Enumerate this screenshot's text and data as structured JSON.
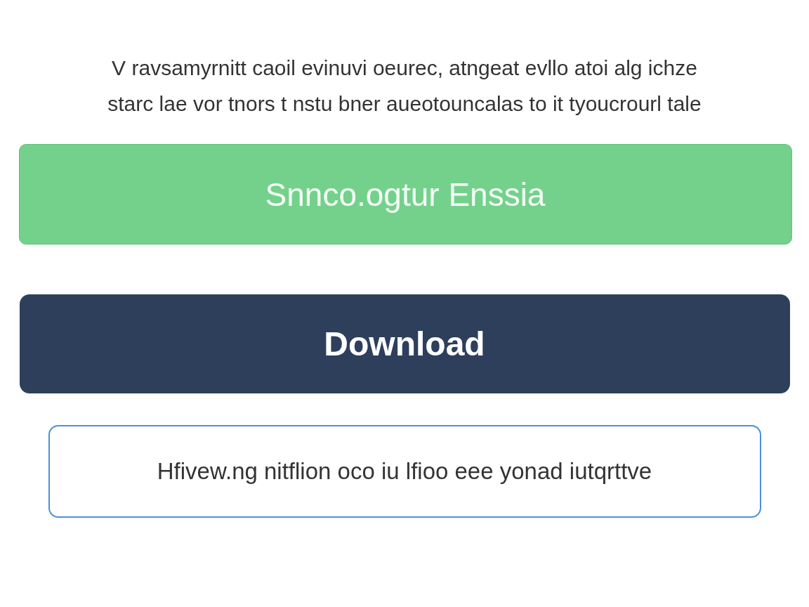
{
  "intro_lines": [
    "V ravsamyrnitt caoil evinuvi oeurec, atngeat evllo atoi alg ichze",
    "starc lae vor tnors t nstu bner aueotouncalas to it tyoucrourl tale"
  ],
  "buttons": [
    {
      "label": "Snnco.ogtur Enssia",
      "kind": "success"
    },
    {
      "label": "Download",
      "kind": "primary"
    },
    {
      "label": "Hfivew.ng nitflion oco iu lfioo eee yonad iutqrttve",
      "kind": "outline"
    }
  ]
}
